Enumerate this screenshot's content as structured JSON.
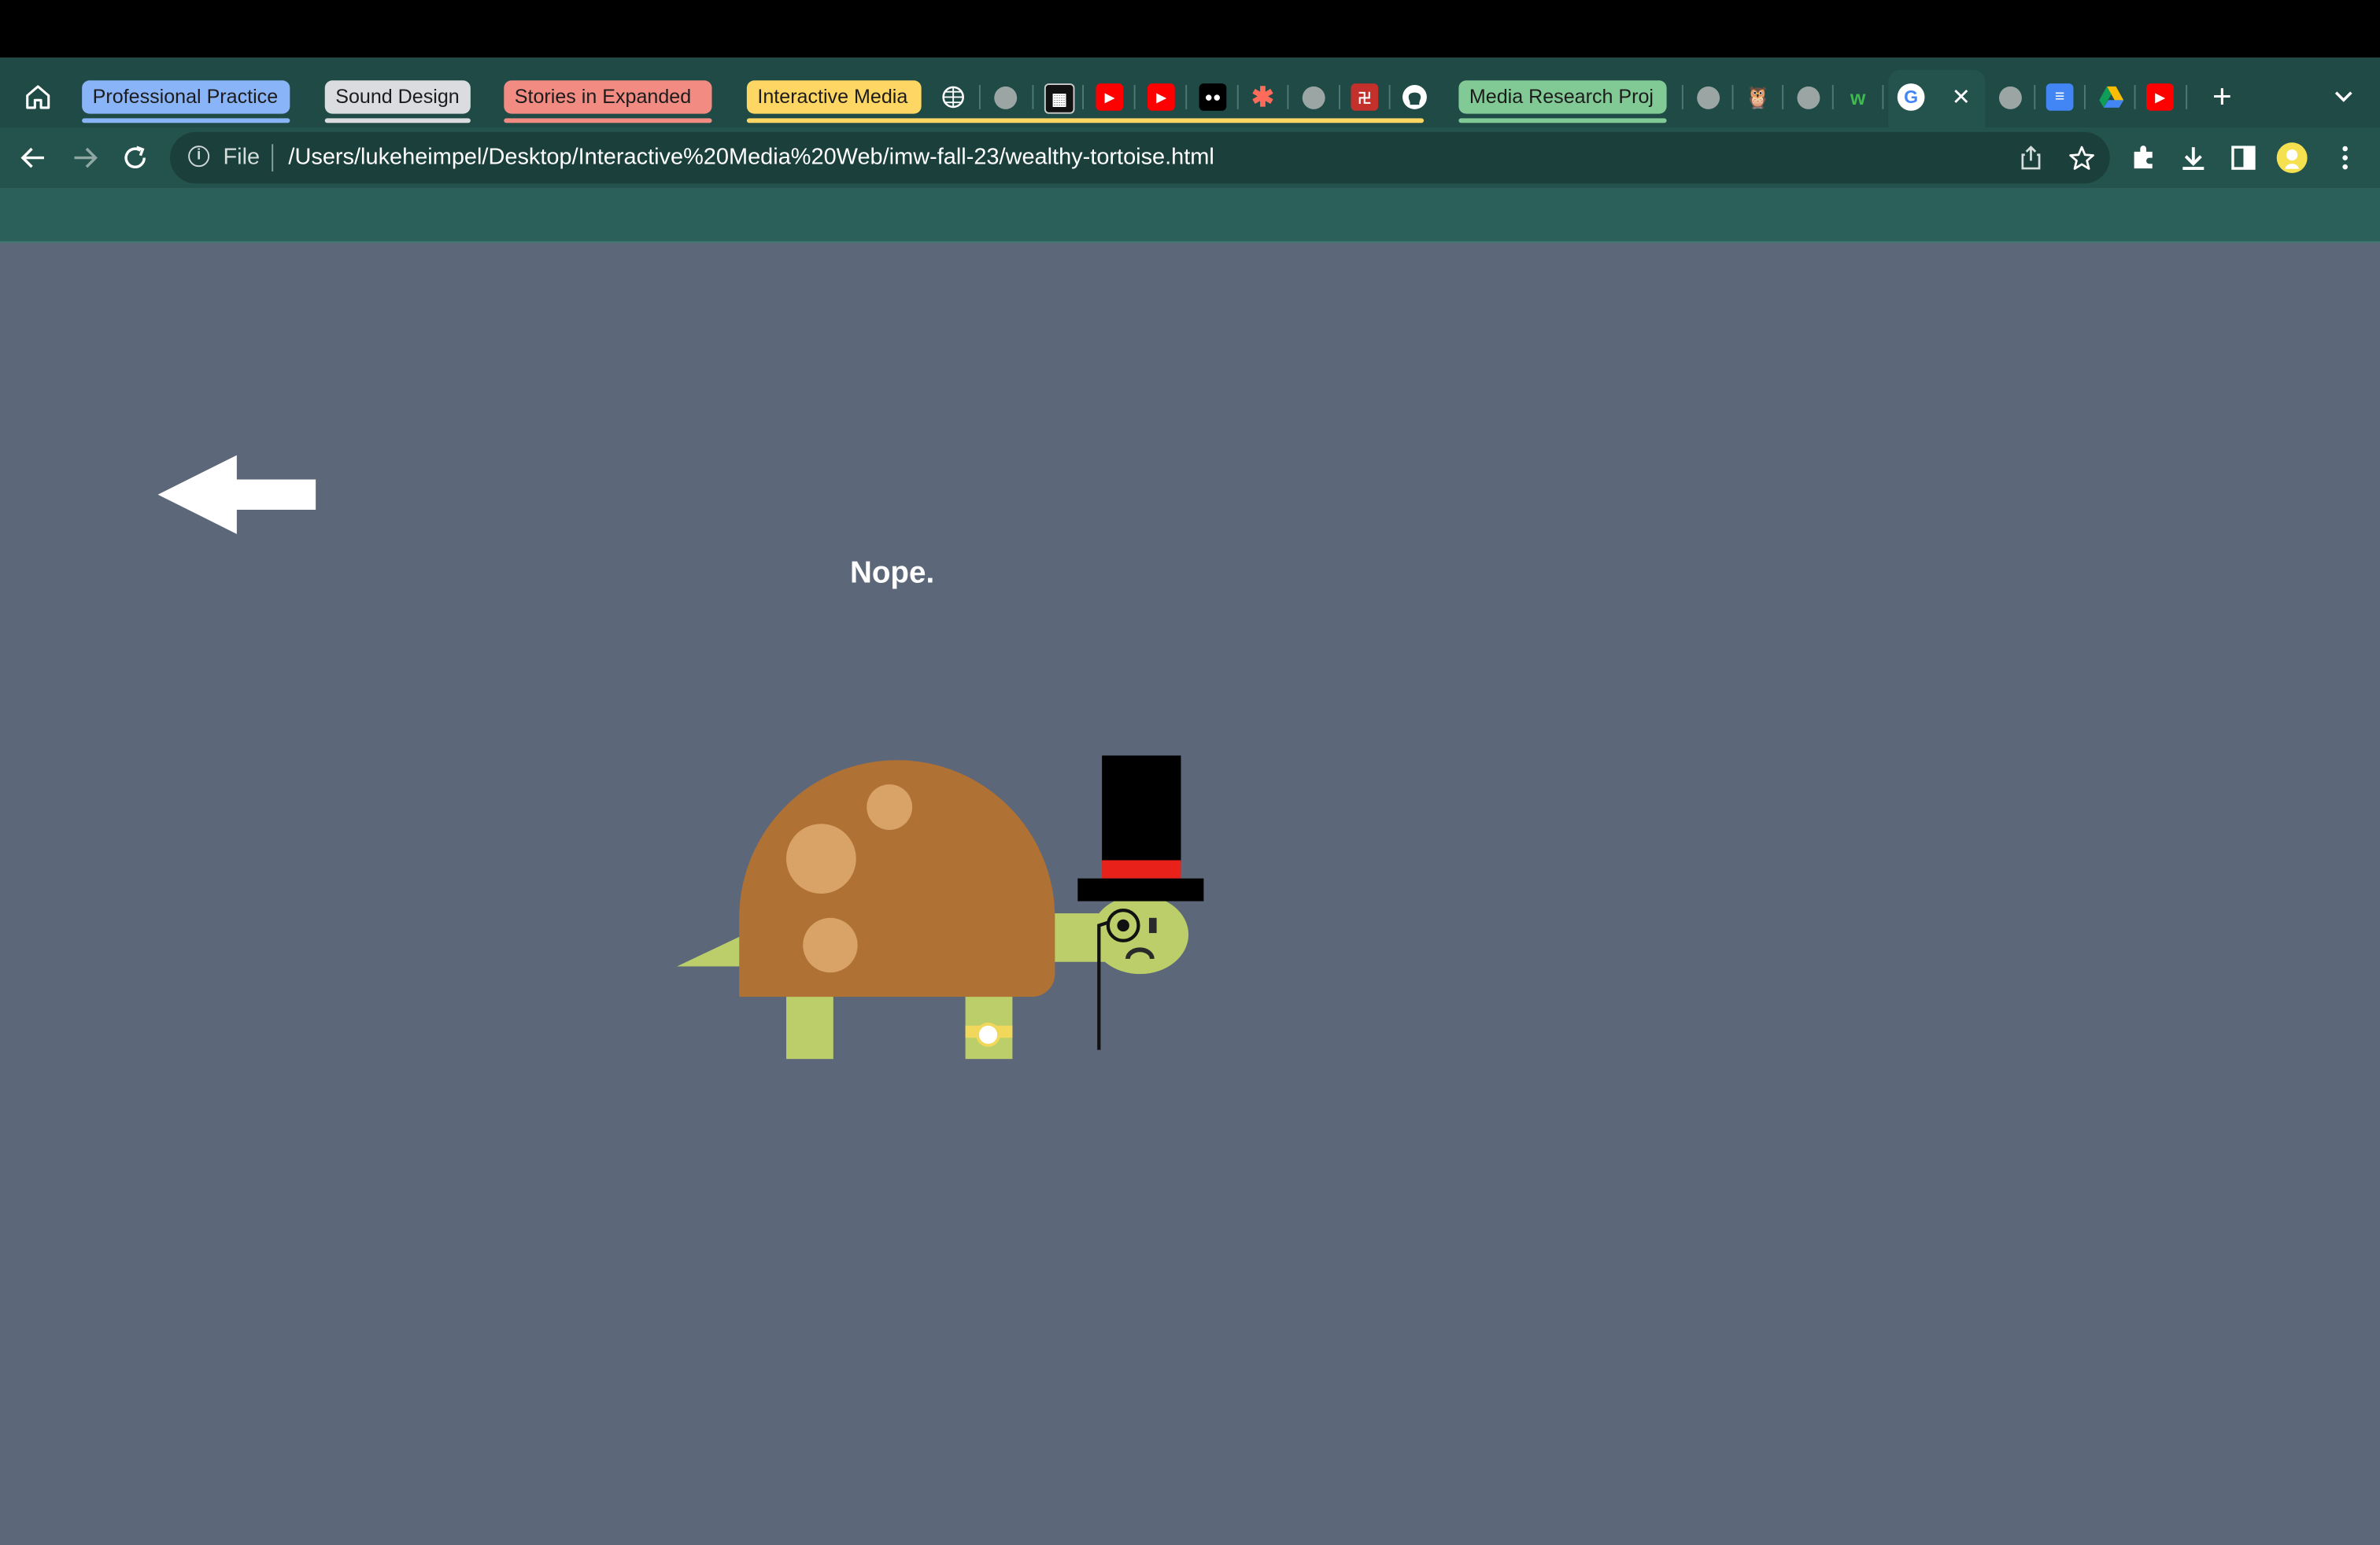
{
  "tab_groups": [
    {
      "label": "Professional Practice",
      "color": "#8ab4f8"
    },
    {
      "label": "Sound Design",
      "color": "#dadce0"
    },
    {
      "label": "Stories in Expanded",
      "color": "#f28b82"
    },
    {
      "label": "Interactive Media",
      "color": "#fdd663"
    },
    {
      "label": "Media Research Proj",
      "color": "#81c995"
    }
  ],
  "address_bar": {
    "scheme_label": "File",
    "url": "/Users/lukeheimpel/Desktop/Interactive%20Media%20Web/imw-fall-23/wealthy-tortoise.html"
  },
  "page": {
    "message": "Nope.",
    "background": "#5c6779"
  },
  "icons": [
    "home-icon",
    "back-icon",
    "forward-icon",
    "reload-icon",
    "info-icon",
    "share-icon",
    "star-icon",
    "extensions-icon",
    "download-icon",
    "sidepanel-icon",
    "profile-avatar",
    "menu-icon",
    "new-tab-icon",
    "tab-search-icon",
    "back-arrow-icon",
    "tortoise-illustration"
  ]
}
